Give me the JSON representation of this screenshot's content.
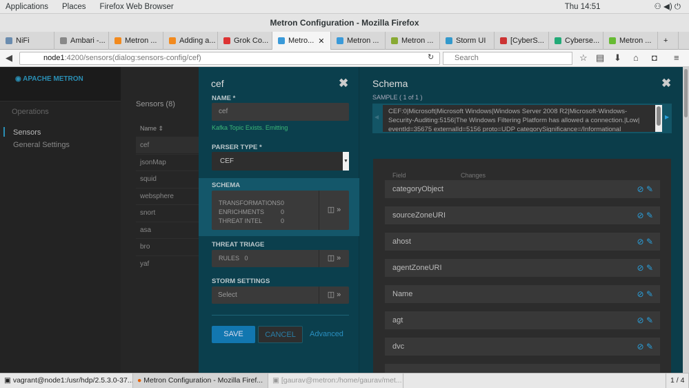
{
  "system": {
    "applications": "Applications",
    "places": "Places",
    "browser": "Firefox Web Browser",
    "clock": "Thu 14:51"
  },
  "window_title": "Metron Configuration - Mozilla Firefox",
  "tabs": [
    {
      "label": "NiFi",
      "color": "#6a8caf"
    },
    {
      "label": "Ambari -...",
      "color": "#888"
    },
    {
      "label": "Metron ...",
      "color": "#f28a1e"
    },
    {
      "label": "Adding a...",
      "color": "#f28a1e"
    },
    {
      "label": "Grok Co...",
      "color": "#d33"
    },
    {
      "label": "Metro...",
      "color": "#3a9ad9"
    },
    {
      "label": "Metron ...",
      "color": "#3a9ad9"
    },
    {
      "label": "Metron ...",
      "color": "#8a3"
    },
    {
      "label": "Storm UI",
      "color": "#39c"
    },
    {
      "label": "[CyberS...",
      "color": "#c33"
    },
    {
      "label": "Cyberse...",
      "color": "#2a7"
    },
    {
      "label": "Metron ...",
      "color": "#6b3"
    }
  ],
  "url": {
    "host": "node1",
    "path": ":4200/sensors(dialog:sensors-config/cef)"
  },
  "search_placeholder": "Search",
  "app": {
    "logo": "APACHE METRON",
    "nav": {
      "section": "Operations",
      "items": [
        "Sensors",
        "General Settings"
      ]
    },
    "sensors": {
      "title": "Sensors (8)",
      "column": "Name ⇕",
      "rows": [
        "cef",
        "jsonMap",
        "squid",
        "websphere",
        "snort",
        "asa",
        "bro",
        "yaf"
      ]
    },
    "config": {
      "title": "cef",
      "name_label": "NAME *",
      "name_value": "cef",
      "kafka_status": "Kafka Topic Exists. Emitting",
      "parser_label": "PARSER TYPE *",
      "parser_value": "CEF",
      "schema_label": "SCHEMA",
      "schema_items": [
        {
          "k": "TRANSFORMATIONS",
          "v": "0"
        },
        {
          "k": "ENRICHMENTS",
          "v": "0"
        },
        {
          "k": "THREAT INTEL",
          "v": "0"
        }
      ],
      "triage_label": "THREAT TRIAGE",
      "rules_label": "RULES",
      "rules_value": "0",
      "storm_label": "STORM SETTINGS",
      "storm_placeholder": "Select",
      "save": "SAVE",
      "cancel": "CANCEL",
      "advanced": "Advanced"
    },
    "schema": {
      "title": "Schema",
      "sample_label": "SAMPLE ( 1 of 1 )",
      "sample_text": "CEF:0|Microsoft|Microsoft Windows|Windows Server 2008 R2|Microsoft-Windows-Security-Auditing:5156|The Windows Filtering Platform has allowed a connection.|Low| eventId=35675 externalId=5156 proto=UDP categorySignificance=/Informational",
      "col_field": "Field",
      "col_changes": "Changes",
      "fields": [
        "categoryObject",
        "sourceZoneURI",
        "ahost",
        "agentZoneURI",
        "Name",
        "agt",
        "dvc"
      ]
    }
  },
  "taskbar": {
    "items": [
      "vagrant@node1:/usr/hdp/2.5.3.0-37...",
      "Metron Configuration - Mozilla Firef...",
      "[gaurav@metron:/home/gaurav/met..."
    ],
    "workspace": "1 / 4"
  }
}
